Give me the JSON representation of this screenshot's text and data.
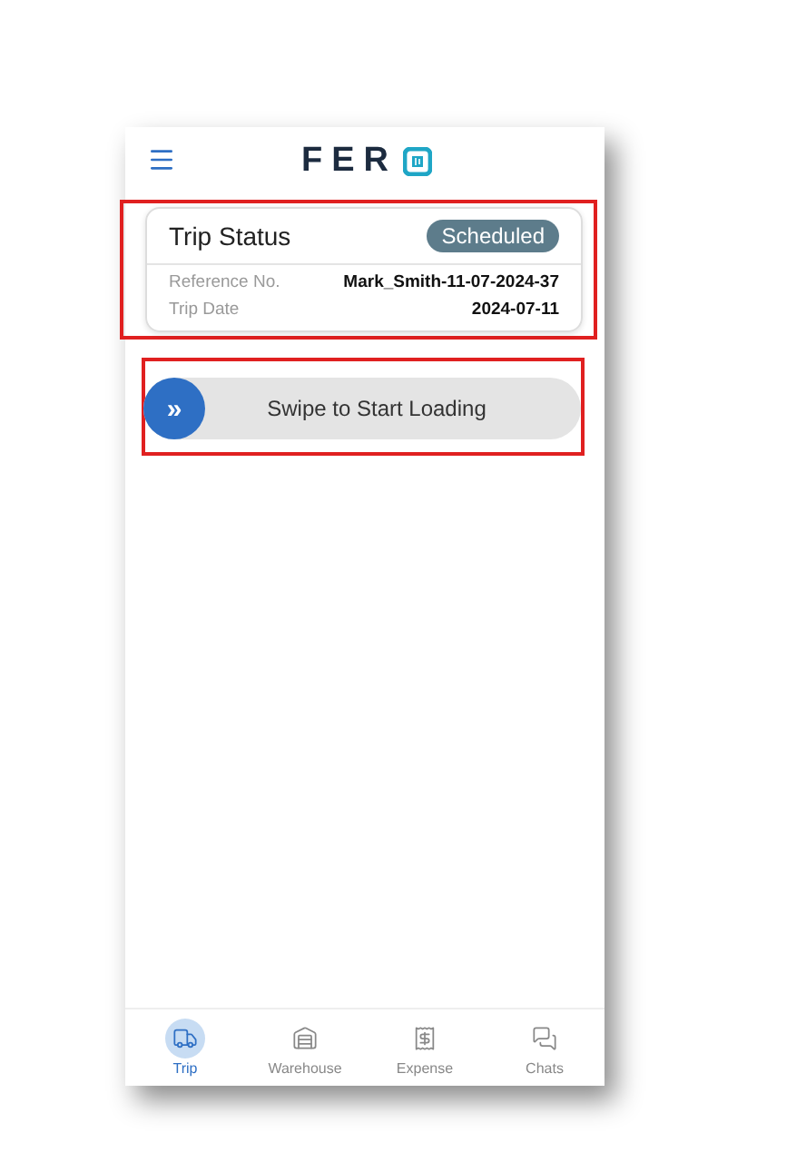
{
  "header": {
    "logo_text": "FER"
  },
  "trip_status": {
    "title": "Trip Status",
    "badge": "Scheduled",
    "details": [
      {
        "label": "Reference No.",
        "value": "Mark_Smith-11-07-2024-37"
      },
      {
        "label": "Trip Date",
        "value": "2024-07-11"
      }
    ],
    "highlighted": true
  },
  "swipe": {
    "label": "Swipe to Start Loading",
    "icon_text": "»",
    "highlighted": true
  },
  "nav": [
    {
      "label": "Trip",
      "kind": "trip",
      "selected": true
    },
    {
      "label": "Warehouse",
      "kind": "warehouse",
      "selected": false
    },
    {
      "label": "Expense",
      "kind": "expense",
      "selected": false
    },
    {
      "label": "Chats",
      "kind": "chats",
      "selected": false
    }
  ]
}
